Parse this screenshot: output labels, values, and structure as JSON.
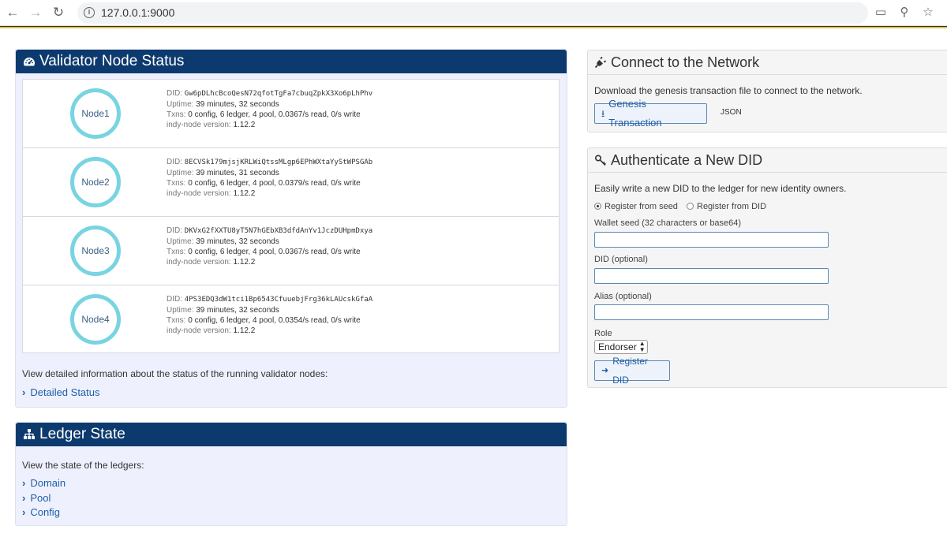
{
  "browser": {
    "url": "127.0.0.1:9000"
  },
  "validator": {
    "title": "Validator Node Status",
    "nodes": [
      {
        "name": "Node1",
        "did_label": "DID:",
        "did": "Gw6pDLhcBcoQesN72qfotTgFa7cbuqZpkX3Xo6pLhPhv",
        "uptime_label": "Uptime:",
        "uptime": "39 minutes, 32 seconds",
        "txns_label": "Txns:",
        "txns": "0 config, 6 ledger, 4 pool, 0.0367/s read, 0/s write",
        "version_label": "indy-node version:",
        "version": "1.12.2"
      },
      {
        "name": "Node2",
        "did_label": "DID:",
        "did": "8ECVSk179mjsjKRLWiQtssMLgp6EPhWXtaYyStWPSGAb",
        "uptime_label": "Uptime:",
        "uptime": "39 minutes, 31 seconds",
        "txns_label": "Txns:",
        "txns": "0 config, 6 ledger, 4 pool, 0.0379/s read, 0/s write",
        "version_label": "indy-node version:",
        "version": "1.12.2"
      },
      {
        "name": "Node3",
        "did_label": "DID:",
        "did": "DKVxG2fXXTU8yT5N7hGEbXB3dfdAnYv1JczDUHpmDxya",
        "uptime_label": "Uptime:",
        "uptime": "39 minutes, 32 seconds",
        "txns_label": "Txns:",
        "txns": "0 config, 6 ledger, 4 pool, 0.0367/s read, 0/s write",
        "version_label": "indy-node version:",
        "version": "1.12.2"
      },
      {
        "name": "Node4",
        "did_label": "DID:",
        "did": "4PS3EDQ3dW1tci1Bp6543CfuuebjFrg36kLAUcskGfaA",
        "uptime_label": "Uptime:",
        "uptime": "39 minutes, 32 seconds",
        "txns_label": "Txns:",
        "txns": "0 config, 6 ledger, 4 pool, 0.0354/s read, 0/s write",
        "version_label": "indy-node version:",
        "version": "1.12.2"
      }
    ],
    "detail_text": "View detailed information about the status of the running validator nodes:",
    "detail_link": "Detailed Status"
  },
  "ledger": {
    "title": "Ledger State",
    "intro": "View the state of the ledgers:",
    "links": [
      "Domain",
      "Pool",
      "Config"
    ]
  },
  "connect": {
    "title": "Connect to the Network",
    "text": "Download the genesis transaction file to connect to the network.",
    "button": "Genesis Transaction",
    "json_link": "JSON"
  },
  "auth": {
    "title": "Authenticate a New DID",
    "text": "Easily write a new DID to the ledger for new identity owners.",
    "radio_seed": "Register from seed",
    "radio_did": "Register from DID",
    "seed_label": "Wallet seed (32 characters or base64)",
    "did_label": "DID (optional)",
    "alias_label": "Alias (optional)",
    "role_label": "Role",
    "role_value": "Endorser",
    "submit": "Register DID"
  }
}
